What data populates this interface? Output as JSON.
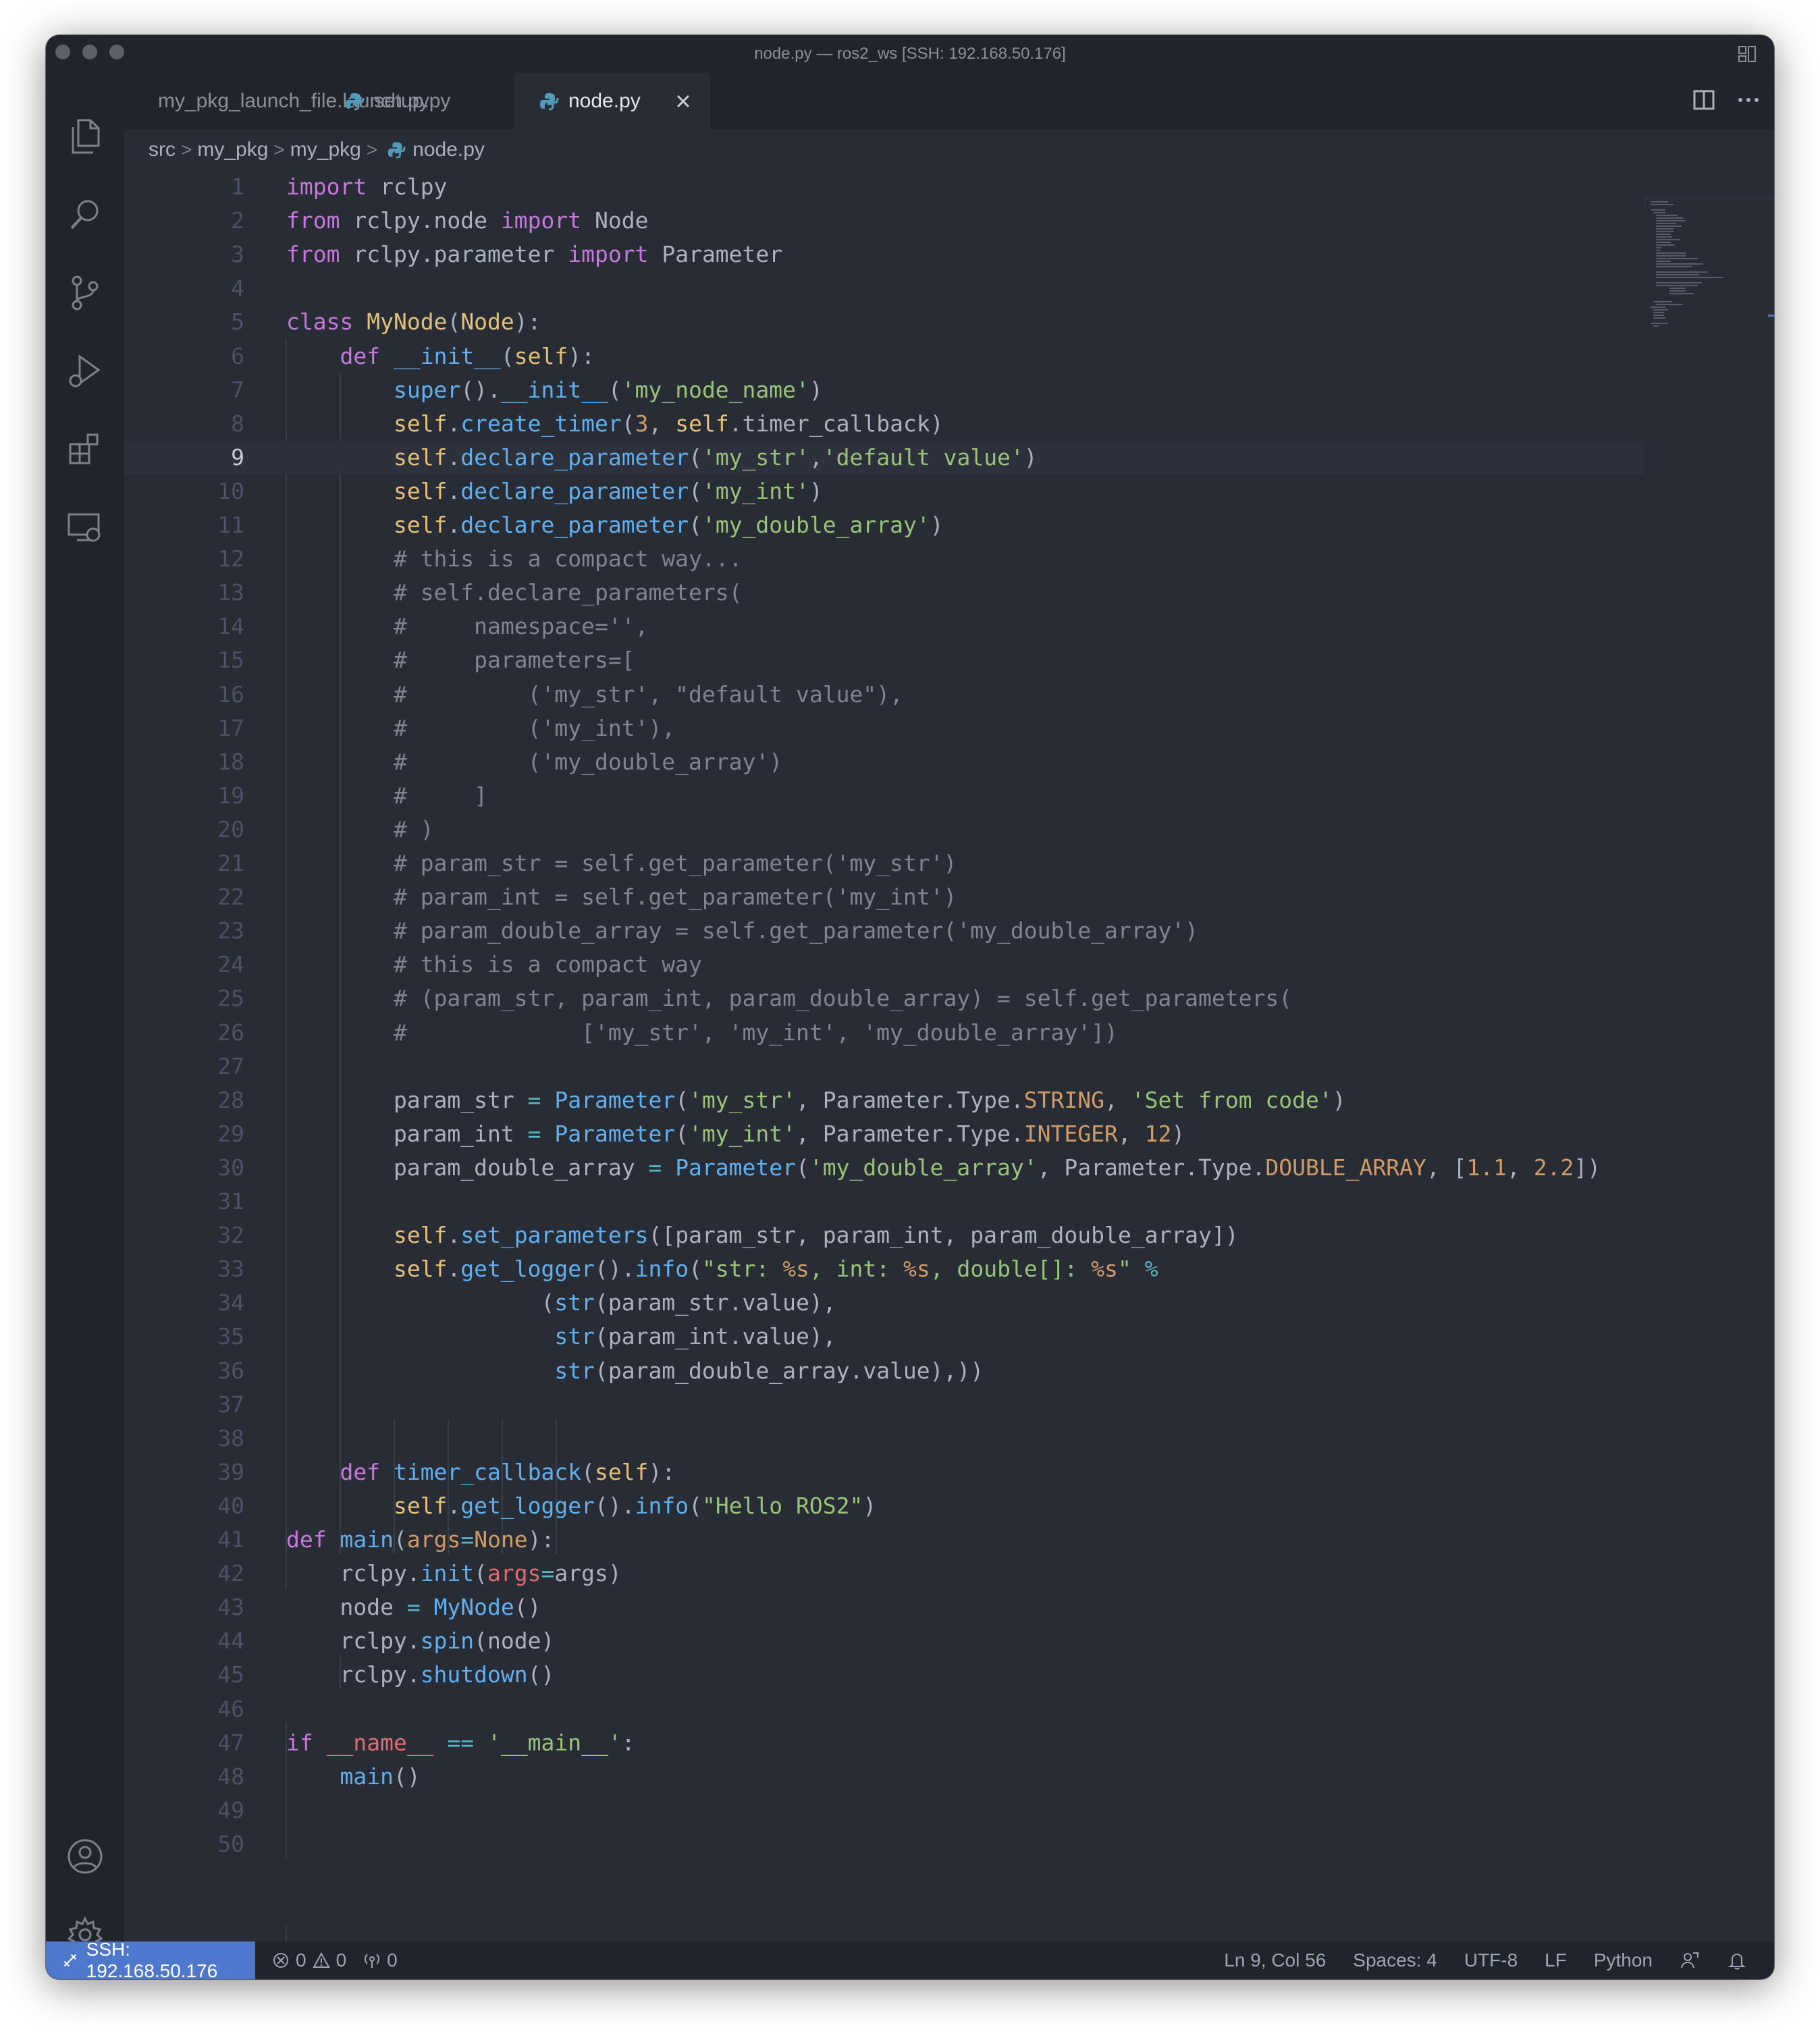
{
  "window": {
    "title": "node.py — ros2_ws [SSH: 192.168.50.176]"
  },
  "tabs": [
    {
      "label": "my_pkg_launch_file.launch.py",
      "active": false
    },
    {
      "label": "setup.py",
      "active": false
    },
    {
      "label": "node.py",
      "active": true
    }
  ],
  "breadcrumb": [
    "src",
    "my_pkg",
    "my_pkg",
    "node.py"
  ],
  "editor": {
    "current_line": 9,
    "lines": [
      [
        [
          "kw",
          "import"
        ],
        [
          "pl",
          " rclpy"
        ]
      ],
      [
        [
          "kw",
          "from"
        ],
        [
          "pl",
          " rclpy.node "
        ],
        [
          "kw",
          "import"
        ],
        [
          "pl",
          " Node"
        ]
      ],
      [
        [
          "kw",
          "from"
        ],
        [
          "pl",
          " rclpy.parameter "
        ],
        [
          "kw",
          "import"
        ],
        [
          "pl",
          " Parameter"
        ]
      ],
      [],
      [
        [
          "kw",
          "class"
        ],
        [
          "pl",
          " "
        ],
        [
          "cls",
          "MyNode"
        ],
        [
          "pl",
          "("
        ],
        [
          "cls",
          "Node"
        ],
        [
          "pl",
          "):"
        ]
      ],
      [
        [
          "pl",
          "    "
        ],
        [
          "kw",
          "def"
        ],
        [
          "pl",
          " "
        ],
        [
          "fn",
          "__init__"
        ],
        [
          "pl",
          "("
        ],
        [
          "self",
          "self"
        ],
        [
          "pl",
          "):"
        ]
      ],
      [
        [
          "pl",
          "        "
        ],
        [
          "fn",
          "super"
        ],
        [
          "pl",
          "()."
        ],
        [
          "fn",
          "__init__"
        ],
        [
          "pl",
          "("
        ],
        [
          "str",
          "'my_node_name'"
        ],
        [
          "pl",
          ")"
        ]
      ],
      [
        [
          "pl",
          "        "
        ],
        [
          "self",
          "self"
        ],
        [
          "pl",
          "."
        ],
        [
          "fn",
          "create_timer"
        ],
        [
          "pl",
          "("
        ],
        [
          "num",
          "3"
        ],
        [
          "pl",
          ", "
        ],
        [
          "self",
          "self"
        ],
        [
          "pl",
          ".timer_callback)"
        ]
      ],
      [
        [
          "pl",
          "        "
        ],
        [
          "self",
          "self"
        ],
        [
          "pl",
          "."
        ],
        [
          "fn",
          "declare_parameter"
        ],
        [
          "pl",
          "("
        ],
        [
          "str",
          "'my_str'"
        ],
        [
          "pl",
          ","
        ],
        [
          "str",
          "'default value'"
        ],
        [
          "pl",
          ")"
        ]
      ],
      [
        [
          "pl",
          "        "
        ],
        [
          "self",
          "self"
        ],
        [
          "pl",
          "."
        ],
        [
          "fn",
          "declare_parameter"
        ],
        [
          "pl",
          "("
        ],
        [
          "str",
          "'my_int'"
        ],
        [
          "pl",
          ")"
        ]
      ],
      [
        [
          "pl",
          "        "
        ],
        [
          "self",
          "self"
        ],
        [
          "pl",
          "."
        ],
        [
          "fn",
          "declare_parameter"
        ],
        [
          "pl",
          "("
        ],
        [
          "str",
          "'my_double_array'"
        ],
        [
          "pl",
          ")"
        ]
      ],
      [
        [
          "pl",
          "        "
        ],
        [
          "cm",
          "# this is a compact way..."
        ]
      ],
      [
        [
          "pl",
          "        "
        ],
        [
          "cm",
          "# self.declare_parameters("
        ]
      ],
      [
        [
          "pl",
          "        "
        ],
        [
          "cm",
          "#     namespace='',"
        ]
      ],
      [
        [
          "pl",
          "        "
        ],
        [
          "cm",
          "#     parameters=["
        ]
      ],
      [
        [
          "pl",
          "        "
        ],
        [
          "cm",
          "#         ('my_str', \"default value\"),"
        ]
      ],
      [
        [
          "pl",
          "        "
        ],
        [
          "cm",
          "#         ('my_int'),"
        ]
      ],
      [
        [
          "pl",
          "        "
        ],
        [
          "cm",
          "#         ('my_double_array')"
        ]
      ],
      [
        [
          "pl",
          "        "
        ],
        [
          "cm",
          "#     ]"
        ]
      ],
      [
        [
          "pl",
          "        "
        ],
        [
          "cm",
          "# )"
        ]
      ],
      [
        [
          "pl",
          "        "
        ],
        [
          "cm",
          "# param_str = self.get_parameter('my_str')"
        ]
      ],
      [
        [
          "pl",
          "        "
        ],
        [
          "cm",
          "# param_int = self.get_parameter('my_int')"
        ]
      ],
      [
        [
          "pl",
          "        "
        ],
        [
          "cm",
          "# param_double_array = self.get_parameter('my_double_array')"
        ]
      ],
      [
        [
          "pl",
          "        "
        ],
        [
          "cm",
          "# this is a compact way"
        ]
      ],
      [
        [
          "pl",
          "        "
        ],
        [
          "cm",
          "# (param_str, param_int, param_double_array) = self.get_parameters("
        ]
      ],
      [
        [
          "pl",
          "        "
        ],
        [
          "cm",
          "#             ['my_str', 'my_int', 'my_double_array'])"
        ]
      ],
      [],
      [
        [
          "pl",
          "        param_str "
        ],
        [
          "op",
          "="
        ],
        [
          "pl",
          " "
        ],
        [
          "fn",
          "Parameter"
        ],
        [
          "pl",
          "("
        ],
        [
          "str",
          "'my_str'"
        ],
        [
          "pl",
          ", Parameter.Type."
        ],
        [
          "num",
          "STRING"
        ],
        [
          "pl",
          ", "
        ],
        [
          "str",
          "'Set from code'"
        ],
        [
          "pl",
          ")"
        ]
      ],
      [
        [
          "pl",
          "        param_int "
        ],
        [
          "op",
          "="
        ],
        [
          "pl",
          " "
        ],
        [
          "fn",
          "Parameter"
        ],
        [
          "pl",
          "("
        ],
        [
          "str",
          "'my_int'"
        ],
        [
          "pl",
          ", Parameter.Type."
        ],
        [
          "num",
          "INTEGER"
        ],
        [
          "pl",
          ", "
        ],
        [
          "num",
          "12"
        ],
        [
          "pl",
          ")"
        ]
      ],
      [
        [
          "pl",
          "        param_double_array "
        ],
        [
          "op",
          "="
        ],
        [
          "pl",
          " "
        ],
        [
          "fn",
          "Parameter"
        ],
        [
          "pl",
          "("
        ],
        [
          "str",
          "'my_double_array'"
        ],
        [
          "pl",
          ", Parameter.Type."
        ],
        [
          "num",
          "DOUBLE_ARRAY"
        ],
        [
          "pl",
          ", ["
        ],
        [
          "num",
          "1.1"
        ],
        [
          "pl",
          ", "
        ],
        [
          "num",
          "2.2"
        ],
        [
          "pl",
          "])"
        ]
      ],
      [],
      [
        [
          "pl",
          "        "
        ],
        [
          "self",
          "self"
        ],
        [
          "pl",
          "."
        ],
        [
          "fn",
          "set_parameters"
        ],
        [
          "pl",
          "([param_str, param_int, param_double_array])"
        ]
      ],
      [
        [
          "pl",
          "        "
        ],
        [
          "self",
          "self"
        ],
        [
          "pl",
          "."
        ],
        [
          "fn",
          "get_logger"
        ],
        [
          "pl",
          "()."
        ],
        [
          "fn",
          "info"
        ],
        [
          "pl",
          "("
        ],
        [
          "str",
          "\"str: "
        ],
        [
          "num",
          "%s"
        ],
        [
          "str",
          ", int: "
        ],
        [
          "num",
          "%s"
        ],
        [
          "str",
          ", double[]: "
        ],
        [
          "num",
          "%s"
        ],
        [
          "str",
          "\""
        ],
        [
          "pl",
          " "
        ],
        [
          "op",
          "%"
        ]
      ],
      [
        [
          "pl",
          "                   ("
        ],
        [
          "fn",
          "str"
        ],
        [
          "pl",
          "(param_str.value),"
        ]
      ],
      [
        [
          "pl",
          "                    "
        ],
        [
          "fn",
          "str"
        ],
        [
          "pl",
          "(param_int.value),"
        ]
      ],
      [
        [
          "pl",
          "                    "
        ],
        [
          "fn",
          "str"
        ],
        [
          "pl",
          "(param_double_array.value),))"
        ]
      ],
      [],
      [],
      [
        [
          "pl",
          "    "
        ],
        [
          "kw",
          "def"
        ],
        [
          "pl",
          " "
        ],
        [
          "fn",
          "timer_callback"
        ],
        [
          "pl",
          "("
        ],
        [
          "self",
          "self"
        ],
        [
          "pl",
          "):"
        ]
      ],
      [
        [
          "pl",
          "        "
        ],
        [
          "self",
          "self"
        ],
        [
          "pl",
          "."
        ],
        [
          "fn",
          "get_logger"
        ],
        [
          "pl",
          "()."
        ],
        [
          "fn",
          "info"
        ],
        [
          "pl",
          "("
        ],
        [
          "str",
          "\"Hello ROS2\""
        ],
        [
          "pl",
          ")"
        ]
      ],
      [
        [
          "kw",
          "def"
        ],
        [
          "pl",
          " "
        ],
        [
          "fn",
          "main"
        ],
        [
          "pl",
          "("
        ],
        [
          "num",
          "args"
        ],
        [
          "op",
          "="
        ],
        [
          "num",
          "None"
        ],
        [
          "pl",
          "):"
        ]
      ],
      [
        [
          "pl",
          "    rclpy."
        ],
        [
          "fn",
          "init"
        ],
        [
          "pl",
          "("
        ],
        [
          "var",
          "args"
        ],
        [
          "op",
          "="
        ],
        [
          "pl",
          "args)"
        ]
      ],
      [
        [
          "pl",
          "    node "
        ],
        [
          "op",
          "="
        ],
        [
          "pl",
          " "
        ],
        [
          "fn",
          "MyNode"
        ],
        [
          "pl",
          "()"
        ]
      ],
      [
        [
          "pl",
          "    rclpy."
        ],
        [
          "fn",
          "spin"
        ],
        [
          "pl",
          "(node)"
        ]
      ],
      [
        [
          "pl",
          "    rclpy."
        ],
        [
          "fn",
          "shutdown"
        ],
        [
          "pl",
          "()"
        ]
      ],
      [],
      [
        [
          "kw",
          "if"
        ],
        [
          "pl",
          " "
        ],
        [
          "var",
          "__name__"
        ],
        [
          "pl",
          " "
        ],
        [
          "op",
          "=="
        ],
        [
          "pl",
          " "
        ],
        [
          "str",
          "'__main__'"
        ],
        [
          "pl",
          ":"
        ]
      ],
      [
        [
          "pl",
          "    "
        ],
        [
          "fn",
          "main"
        ],
        [
          "pl",
          "()"
        ]
      ],
      [],
      []
    ]
  },
  "statusbar": {
    "remote": "SSH: 192.168.50.176",
    "errors": "0",
    "warnings": "0",
    "ports": "0",
    "position": "Ln 9, Col 56",
    "spaces": "Spaces: 4",
    "encoding": "UTF-8",
    "eol": "LF",
    "language": "Python"
  },
  "colors": {
    "accent": "#4d78cc",
    "background": "#282c34",
    "chrome": "#21252b"
  },
  "icons": [
    "explorer-icon",
    "search-icon",
    "source-control-icon",
    "run-debug-icon",
    "extensions-icon",
    "remote-explorer-icon",
    "account-icon",
    "settings-gear-icon",
    "python-file-icon",
    "close-icon",
    "split-editor-icon",
    "more-actions-icon"
  ]
}
